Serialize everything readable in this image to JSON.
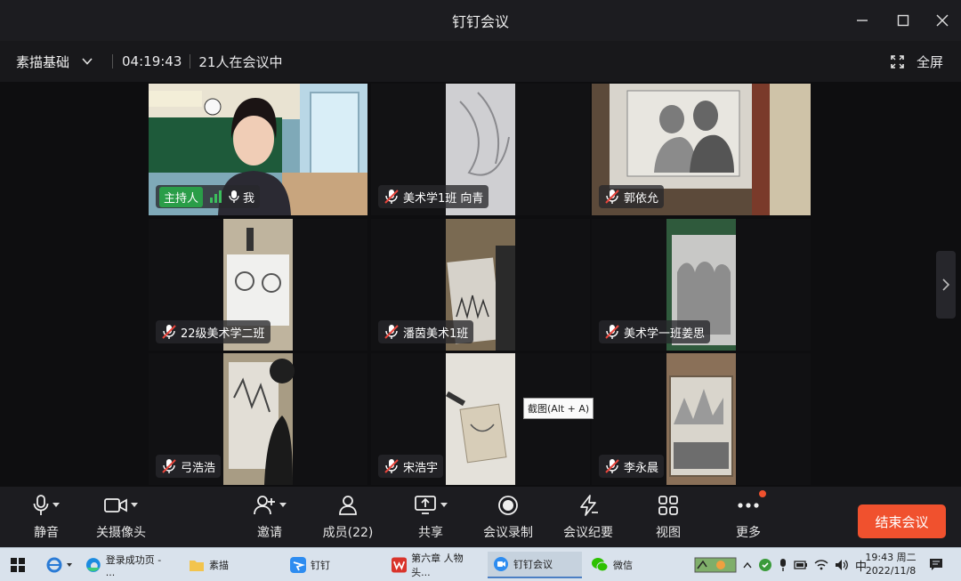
{
  "window": {
    "title": "钉钉会议",
    "minimize_icon": "minimize-icon",
    "maximize_icon": "maximize-icon",
    "close_icon": "close-icon"
  },
  "infobar": {
    "meeting_name": "素描基础",
    "elapsed": "04:19:43",
    "participants_text": "21人在会议中",
    "fullscreen_label": "全屏"
  },
  "tiles": [
    {
      "host_badge": "主持人",
      "name": "我",
      "muted": false
    },
    {
      "name": "美术学1班 向青",
      "muted": true
    },
    {
      "name": "郭依允",
      "muted": true
    },
    {
      "name": "22级美术学二班",
      "muted": true
    },
    {
      "name": "潘茵美术1班",
      "muted": true
    },
    {
      "name": "美术学一班姜思",
      "muted": true
    },
    {
      "name": "弓浩浩",
      "muted": true
    },
    {
      "name": "宋浩宇",
      "muted": true
    },
    {
      "name": "李永晨",
      "muted": true
    }
  ],
  "tooltip": "截图(Alt + A)",
  "toolbar": {
    "mute": "静音",
    "camera": "关摄像头",
    "invite": "邀请",
    "members": "成员(22)",
    "share": "共享",
    "record": "会议录制",
    "minutes": "会议纪要",
    "view": "视图",
    "more": "更多",
    "end": "结束会议"
  },
  "taskbar": {
    "items": [
      "登录成功页 - ...",
      "素描",
      "钉钉",
      "第六章 人物头...",
      "钉钉会议",
      "微信"
    ],
    "ime": "中",
    "time": "19:43 周二",
    "date": "2022/11/8"
  },
  "colors": {
    "accent_green": "#2a9d48",
    "end_button": "#f0512e",
    "muted_red": "#e8453c"
  }
}
